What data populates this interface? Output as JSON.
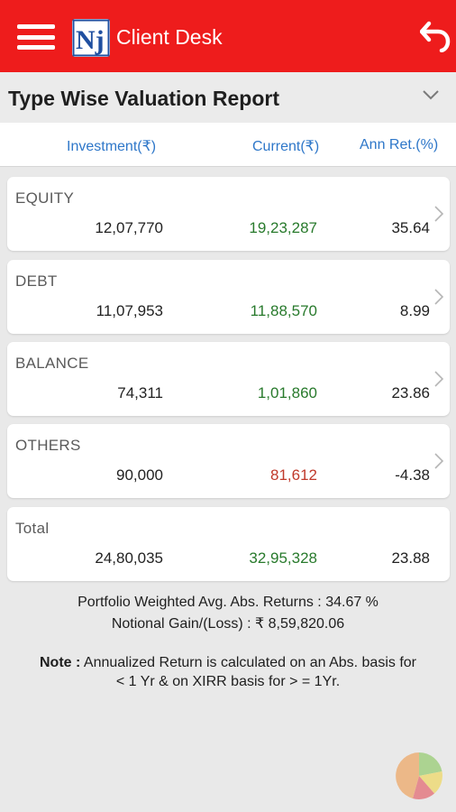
{
  "app": {
    "title": "Client Desk",
    "logo_text": "Nj",
    "bar_color": "#ee1c1c"
  },
  "icons": {
    "menu": "hamburger-menu-icon",
    "back": "back-arrow-icon",
    "dropdown": "chevron-down-icon",
    "row": "chevron-right-icon",
    "pie": "pie-chart-icon"
  },
  "report": {
    "title": "Type Wise Valuation Report"
  },
  "columns": {
    "investment": "Investment(₹)",
    "current": "Current(₹)",
    "ann_ret": "Ann Ret.(%)"
  },
  "rows": [
    {
      "name": "EQUITY",
      "investment": "12,07,770",
      "current": "19,23,287",
      "ann_ret": "35.64",
      "current_color": "green"
    },
    {
      "name": "DEBT",
      "investment": "11,07,953",
      "current": "11,88,570",
      "ann_ret": "8.99",
      "current_color": "green"
    },
    {
      "name": "BALANCE",
      "investment": "74,311",
      "current": "1,01,860",
      "ann_ret": "23.86",
      "current_color": "green"
    },
    {
      "name": "OTHERS",
      "investment": "90,000",
      "current": "81,612",
      "ann_ret": "-4.38",
      "current_color": "red"
    }
  ],
  "total": {
    "name": "Total",
    "investment": "24,80,035",
    "current": "32,95,328",
    "ann_ret": "23.88"
  },
  "summary": {
    "weighted": "Portfolio Weighted Avg. Abs. Returns : 34.67 %",
    "notional": "Notional Gain/(Loss) : ₹ 8,59,820.06"
  },
  "note": {
    "label": "Note :",
    "line1": "Annualized Return is calculated on an Abs. basis for",
    "line2": "< 1 Yr & on XIRR basis for > = 1Yr."
  }
}
